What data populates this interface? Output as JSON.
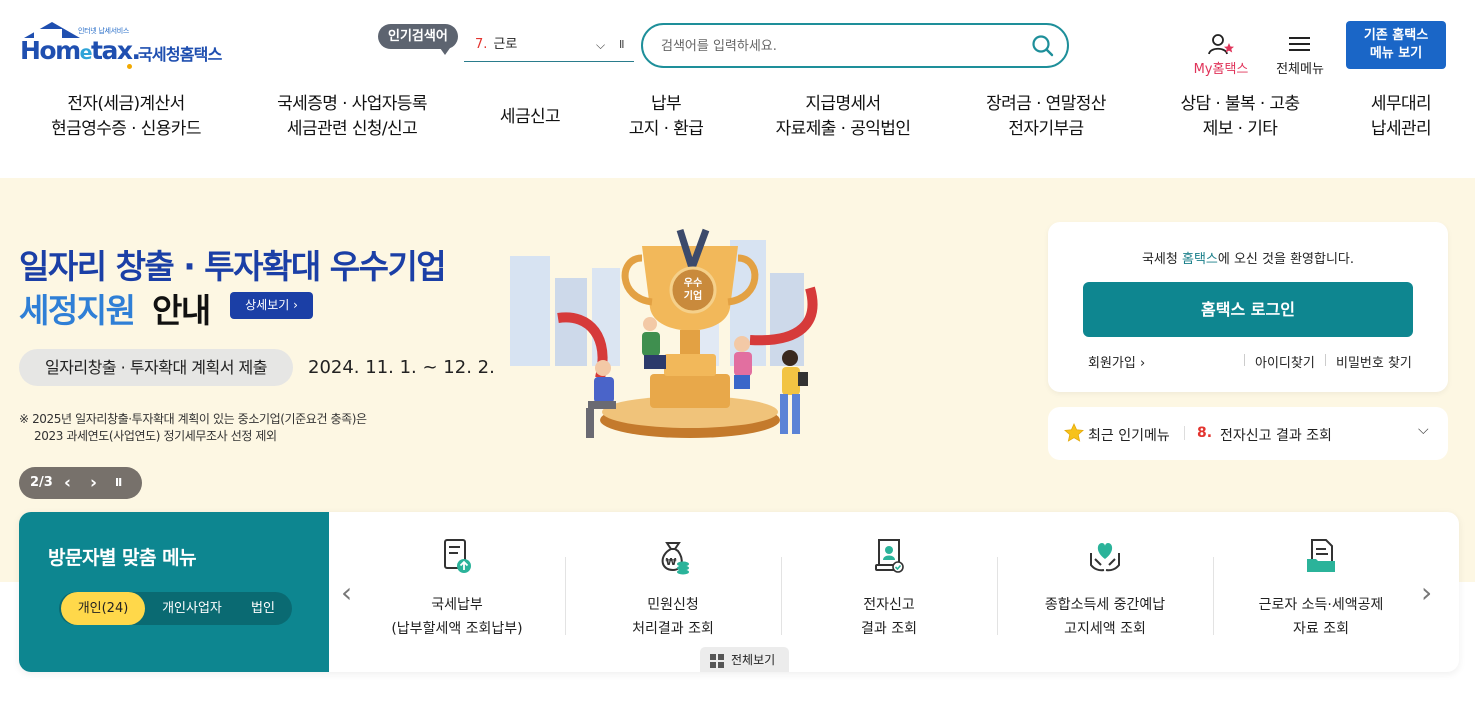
{
  "header": {
    "logo_tagline": "인터넷 납세서비스",
    "logo_en_pre": "Hom",
    "logo_en_e": "e",
    "logo_en_post": "tax.",
    "logo_ko": "국세청홈택스",
    "popular_label": "인기검색어",
    "popular_rank": "7.",
    "popular_keyword": "근로",
    "popular_chevron": "⌵",
    "popular_pause": "II",
    "search_placeholder": "검색어를 입력하세요.",
    "my_hometax_label": "My홈택스",
    "all_menu_label": "전체메뉴",
    "old_menu_line1": "기존 홈택스",
    "old_menu_line2": "메뉴 보기"
  },
  "gnb": [
    {
      "line1": "전자(세금)계산서",
      "line2": "현금영수증 · 신용카드"
    },
    {
      "line1": "국세증명 · 사업자등록",
      "line2": "세금관련 신청/신고"
    },
    {
      "line1": "세금신고",
      "line2": ""
    },
    {
      "line1": "납부",
      "line2": "고지 · 환급"
    },
    {
      "line1": "지급명세서",
      "line2": "자료제출 · 공익법인"
    },
    {
      "line1": "장려금 · 연말정산",
      "line2": "전자기부금"
    },
    {
      "line1": "상담 · 불복 · 고충",
      "line2": "제보 · 기타"
    },
    {
      "line1": "세무대리",
      "line2": "납세관리"
    }
  ],
  "banner": {
    "title_line1": "일자리 창출 · 투자확대 우수기업",
    "title_line2_blue": "세정지원",
    "title_line2_black": "안내",
    "detail_button": "상세보기 ›",
    "pill_text": "일자리창출 · 투자확대 계획서 제출",
    "period": "2024. 11. 1. ~ 12. 2.",
    "note_line1": "※ 2025년 일자리창출·투자확대 계획이 있는 중소기업(기준요건 충족)은",
    "note_line2": "2023 과세연도(사업연도) 정기세무조사 선정 제외",
    "pager_text": "2/3",
    "pager_prev": "‹",
    "pager_next": "›",
    "pager_pause": "II",
    "trophy_badge_line1": "우수",
    "trophy_badge_line2": "기업"
  },
  "login": {
    "welcome_pre": "국세청 ",
    "welcome_hl": "홈택스",
    "welcome_post": "에 오신 것을 환영합니다.",
    "login_button": "홈택스 로그인",
    "join_label": "회원가입 ›",
    "find_id": "아이디찾기",
    "find_pw": "비밀번호 찾기"
  },
  "hot_menu": {
    "label": "최근 인기메뉴",
    "rank": "8.",
    "value": "전자신고 결과 조회",
    "chevron": "⌵"
  },
  "visitor": {
    "title": "방문자별 맞춤 메뉴",
    "tabs": [
      "개인(24)",
      "개인사업자",
      "법인"
    ],
    "prev_arrow": "‹",
    "next_arrow": "›",
    "items": [
      {
        "line1": "국세납부",
        "line2": "(납부할세액 조회납부)",
        "icon": "tax-payment-icon"
      },
      {
        "line1": "민원신청",
        "line2": "처리결과 조회",
        "icon": "money-bag-icon"
      },
      {
        "line1": "전자신고",
        "line2": "결과 조회",
        "icon": "certificate-icon"
      },
      {
        "line1": "종합소득세 중간예납",
        "line2": "고지세액 조회",
        "icon": "heart-hands-icon"
      },
      {
        "line1": "근로자 소득·세액공제",
        "line2": "자료 조회",
        "icon": "document-folder-icon"
      }
    ],
    "view_all": "전체보기"
  },
  "colors": {
    "brand_blue": "#1f4fb0",
    "teal": "#0d8690",
    "banner_bg": "#fdf7e3",
    "accent_yellow": "#ffd84a",
    "rank_red": "#e3342f"
  }
}
